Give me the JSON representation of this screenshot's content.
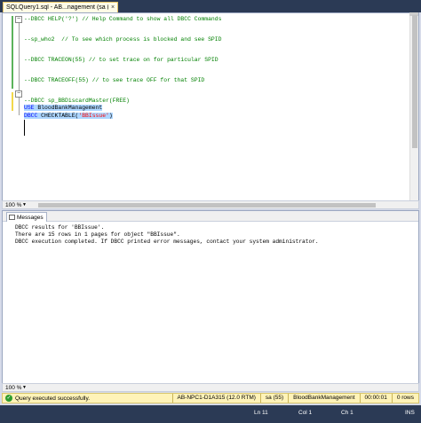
{
  "tab": {
    "title": "SQLQuery1.sql - AB...nagement (sa (55))*",
    "close_glyph": "×"
  },
  "editor": {
    "lines": [
      {
        "parts": [
          {
            "t": "--DBCC HELP('?') // Help Command to show all DBCC Commands",
            "c": "comment"
          }
        ]
      },
      {
        "parts": [
          {
            "t": "",
            "c": "plain"
          }
        ]
      },
      {
        "parts": [
          {
            "t": "--sp_who2  // To see which process is blocked and see SPID",
            "c": "comment"
          }
        ]
      },
      {
        "parts": [
          {
            "t": "",
            "c": "plain"
          }
        ]
      },
      {
        "parts": [
          {
            "t": "--DBCC TRACEON(55) // to set trace on for particular SPID",
            "c": "comment"
          }
        ]
      },
      {
        "parts": [
          {
            "t": "",
            "c": "plain"
          }
        ]
      },
      {
        "parts": [
          {
            "t": "--DBCC TRACEOFF(55) // to see trace OFF for that SPID",
            "c": "comment"
          }
        ]
      },
      {
        "parts": [
          {
            "t": "",
            "c": "plain"
          }
        ]
      },
      {
        "parts": [
          {
            "t": "--DBCC sp_BBDiscardMaster(FREE)",
            "c": "comment"
          }
        ]
      },
      {
        "parts": [
          {
            "t": "",
            "c": "plain"
          }
        ]
      },
      {
        "parts": [
          {
            "t": "USE",
            "c": "kw"
          },
          {
            "t": " BloodBankManagement",
            "c": "plain"
          }
        ],
        "selected": true
      },
      {
        "parts": [
          {
            "t": "DBCC",
            "c": "kw"
          },
          {
            "t": " CHECKTABLE(",
            "c": "plain"
          },
          {
            "t": "'BBIssue'",
            "c": "str"
          },
          {
            "t": ")",
            "c": "plain"
          }
        ],
        "selected": true
      }
    ]
  },
  "editor_zoom": {
    "label": "100 %",
    "dropdown": "▼"
  },
  "messages_tab": {
    "label": "Messages"
  },
  "messages": [
    "DBCC results for 'BBIssue'.",
    "There are 15 rows in 1 pages for object \"BBIssue\".",
    "DBCC execution completed. If DBCC printed error messages, contact your system administrator."
  ],
  "results_zoom": {
    "label": "100 %",
    "dropdown": "▼"
  },
  "query_status": {
    "icon": "check-circle-icon",
    "text": "Query executed successfully.",
    "server": "AB-NPC1-D1A315 (12.0 RTM)",
    "user": "sa (55)",
    "database": "BloodBankManagement",
    "elapsed": "00:00:01",
    "rows": "0 rows"
  },
  "app_status": {
    "line": "Ln 11",
    "col": "Col 1",
    "ch": "Ch 1",
    "mode": "INS"
  },
  "colors": {
    "comment": "#008000",
    "keyword": "#0000ff",
    "string": "#ff0000",
    "selection": "#add6ff",
    "status_ok": "#fff3b8",
    "chrome": "#2b3a55"
  }
}
